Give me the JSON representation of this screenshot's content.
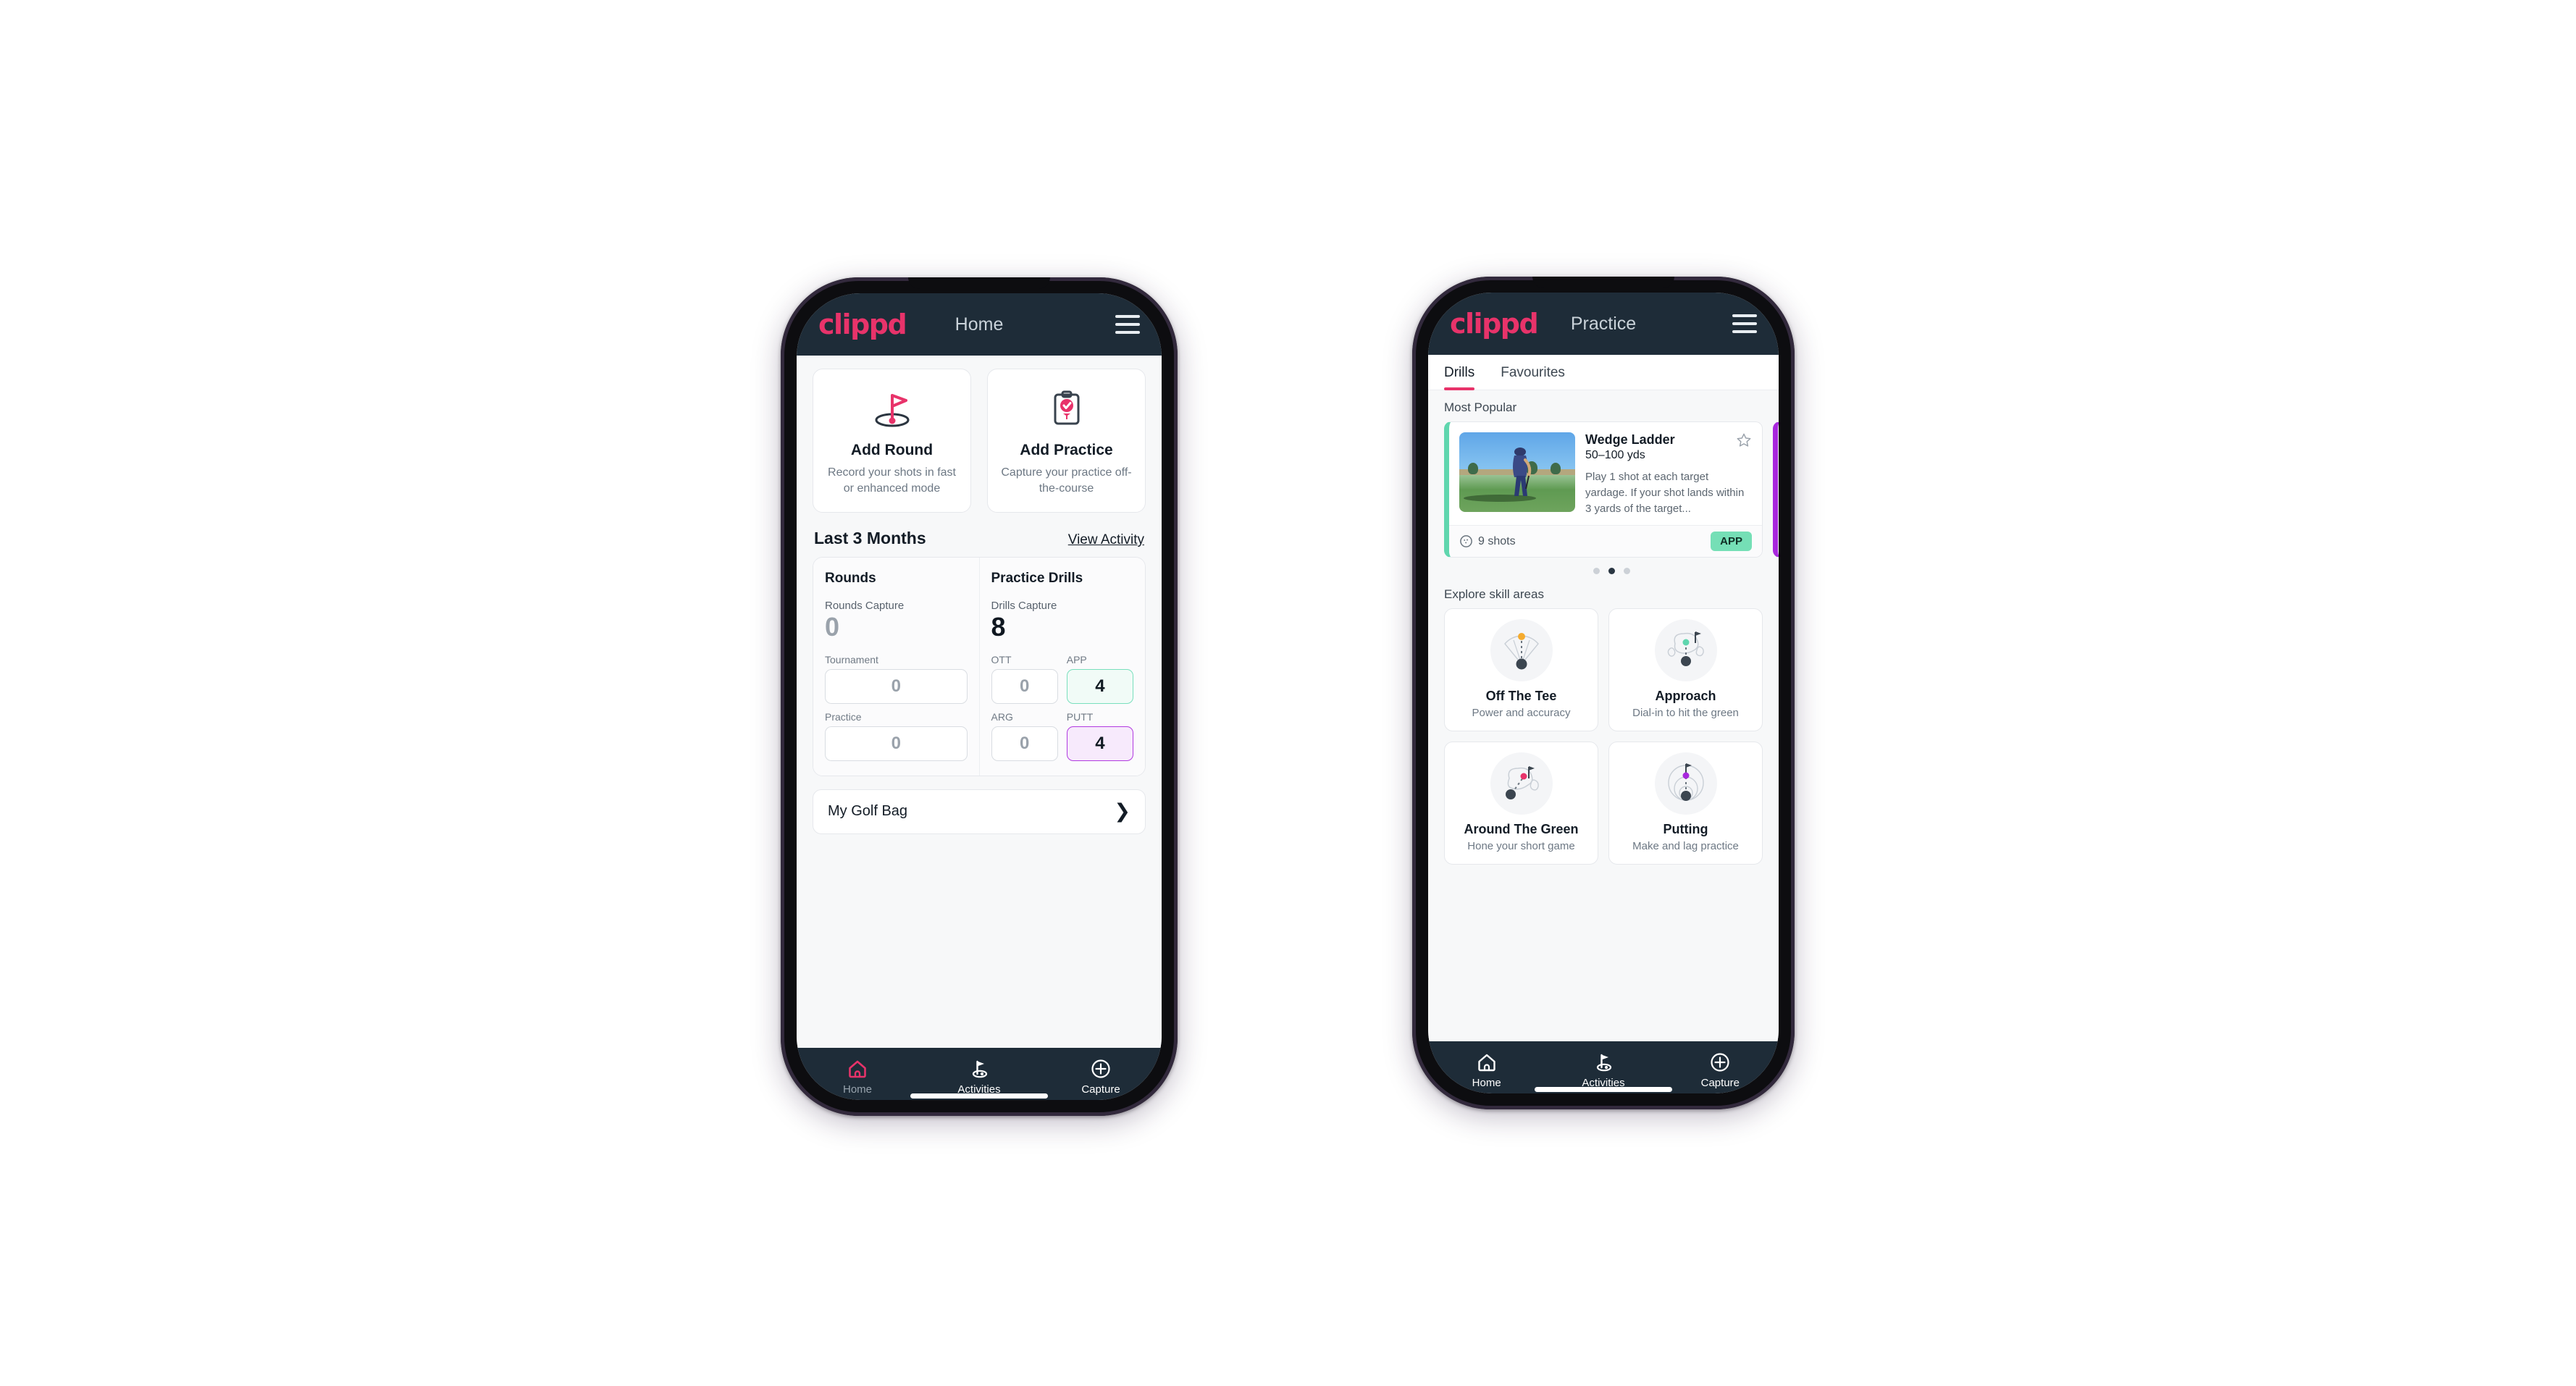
{
  "brand": "clippd",
  "accent_pink": "#e8336a",
  "appbar_bg": "#1e2c38",
  "accent_green": "#75dfb6",
  "accent_purple": "#a827dd",
  "home": {
    "title": "Home",
    "menu_icon": "hamburger-icon",
    "quick_actions": [
      {
        "icon": "golf-flag-hole-icon",
        "title": "Add Round",
        "subtitle": "Record your shots in fast or enhanced mode"
      },
      {
        "icon": "clipboard-check-tee-icon",
        "title": "Add Practice",
        "subtitle": "Capture your practice off-the-course"
      }
    ],
    "section": {
      "title": "Last 3 Months",
      "link": "View Activity"
    },
    "rounds": {
      "title": "Rounds",
      "capture_label": "Rounds Capture",
      "capture_value": "0",
      "metrics": [
        {
          "label": "Tournament",
          "value": "0",
          "state": "empty"
        },
        {
          "label": "Practice",
          "value": "0",
          "state": "empty"
        }
      ]
    },
    "drills": {
      "title": "Practice Drills",
      "capture_label": "Drills Capture",
      "capture_value": "8",
      "metrics": [
        {
          "label": "OTT",
          "value": "0",
          "state": "empty"
        },
        {
          "label": "APP",
          "value": "4",
          "state": "app"
        },
        {
          "label": "ARG",
          "value": "0",
          "state": "empty"
        },
        {
          "label": "PUTT",
          "value": "4",
          "state": "putt"
        }
      ]
    },
    "golf_bag": {
      "label": "My Golf Bag",
      "chevron": "chevron-right-icon"
    },
    "nav": [
      {
        "label": "Home",
        "icon": "home-icon",
        "active": true
      },
      {
        "label": "Activities",
        "icon": "golf-flag-icon",
        "active": false
      },
      {
        "label": "Capture",
        "icon": "plus-circle-icon",
        "active": false
      }
    ]
  },
  "practice": {
    "title": "Practice",
    "menu_icon": "hamburger-icon",
    "tabs": [
      {
        "label": "Drills",
        "active": true
      },
      {
        "label": "Favourites",
        "active": false
      }
    ],
    "most_popular_label": "Most Popular",
    "drill_card": {
      "title": "Wedge Ladder",
      "subtitle": "50–100 yds",
      "description": "Play 1 shot at each target yardage. If your shot lands within 3 yards of the target...",
      "shots": "9 shots",
      "shots_icon": "golf-ball-icon",
      "badge": "APP",
      "favourite_icon": "star-outline-icon",
      "accent": "#5fd6ae",
      "thumbnail_alt": "golfer-chipping-photo"
    },
    "next_card_accent": "#a827dd",
    "carousel_dots": {
      "count": 3,
      "active_index": 1
    },
    "skill_label": "Explore skill areas",
    "skills": [
      {
        "title": "Off The Tee",
        "subtitle": "Power and accuracy",
        "icon": "tee-dispersion-icon",
        "dot_color": "#f5ab2e"
      },
      {
        "title": "Approach",
        "subtitle": "Dial-in to hit the green",
        "icon": "approach-green-icon",
        "dot_color": "#5fd6ae"
      },
      {
        "title": "Around The Green",
        "subtitle": "Hone your short game",
        "icon": "chipping-green-icon",
        "dot_color": "#e8336a"
      },
      {
        "title": "Putting",
        "subtitle": "Make and lag practice",
        "icon": "putting-rings-icon",
        "dot_color": "#a827dd"
      }
    ],
    "nav": [
      {
        "label": "Home",
        "icon": "home-icon",
        "active": false
      },
      {
        "label": "Activities",
        "icon": "golf-flag-icon",
        "active": true
      },
      {
        "label": "Capture",
        "icon": "plus-circle-icon",
        "active": false
      }
    ]
  }
}
